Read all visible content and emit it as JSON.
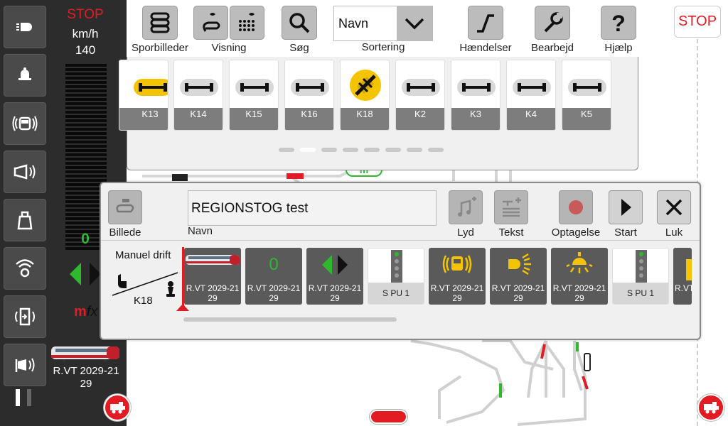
{
  "colors": {
    "accent_red": "#e31b23",
    "accent_green": "#2eb82e",
    "yellow": "#f5c400",
    "panel_dark": "#2c2c2c"
  },
  "left_panel": {
    "stop": "STOP",
    "speed_unit": "km/h",
    "max_speed": "140",
    "current_speed": "0",
    "decoder_prefix": "m",
    "decoder_suffix": "fx",
    "loco_name": "R.VT 2029-21 29",
    "function_icons": [
      "light-icon",
      "bell-icon",
      "sound-icon",
      "horn-icon",
      "bag-icon",
      "radio-icon",
      "door-icon",
      "announcement-icon"
    ]
  },
  "right_stop": "STOP",
  "toolbar": {
    "items": [
      {
        "label": "Sporbilleder",
        "icon": "track-layout-icon"
      },
      {
        "label": "Visning",
        "icon": "view-icon"
      },
      {
        "label": "Søg",
        "icon": "search-icon"
      },
      {
        "label": "Hændelser",
        "icon": "events-icon"
      },
      {
        "label": "Bearbejd",
        "icon": "wrench-icon"
      },
      {
        "label": "Hjælp",
        "icon": "help-icon"
      }
    ],
    "sort_value": "Navn",
    "sort_label": "Sortering"
  },
  "carousel": {
    "cards": [
      "K13",
      "K14",
      "K15",
      "K16",
      "K18",
      "K2",
      "K3",
      "K4",
      "K5"
    ],
    "selected": "K18",
    "page": 2,
    "pages": 8
  },
  "track": {
    "m_tag": "m"
  },
  "dialog": {
    "image_label": "Billede",
    "name_value": "REGIONSTOG test",
    "name_label": "Navn",
    "sound_label": "Lyd",
    "text_label": "Tekst",
    "record_label": "Optagelse",
    "start_label": "Start",
    "close_label": "Luk",
    "manual_label": "Manuel drift",
    "track_label": "K18",
    "sequence": [
      {
        "type": "loco",
        "label": "R.VT 2029-21 29",
        "style": "dark"
      },
      {
        "type": "speed",
        "value": "0",
        "label": "R.VT 2029-21 29",
        "style": "dark"
      },
      {
        "type": "direction",
        "label": "R.VT 2029-21 29",
        "style": "dark"
      },
      {
        "type": "signal",
        "label": "S PU 1",
        "style": "light"
      },
      {
        "type": "sound",
        "label": "R.VT 2029-21 29",
        "style": "dark"
      },
      {
        "type": "light",
        "label": "R.VT 2029-21 29",
        "style": "dark"
      },
      {
        "type": "lamp",
        "label": "R.VT 2029-21 29",
        "style": "dark"
      },
      {
        "type": "signal",
        "label": "S PU 1",
        "style": "light"
      },
      {
        "type": "partial",
        "label": "R.VT",
        "style": "dark"
      }
    ]
  }
}
